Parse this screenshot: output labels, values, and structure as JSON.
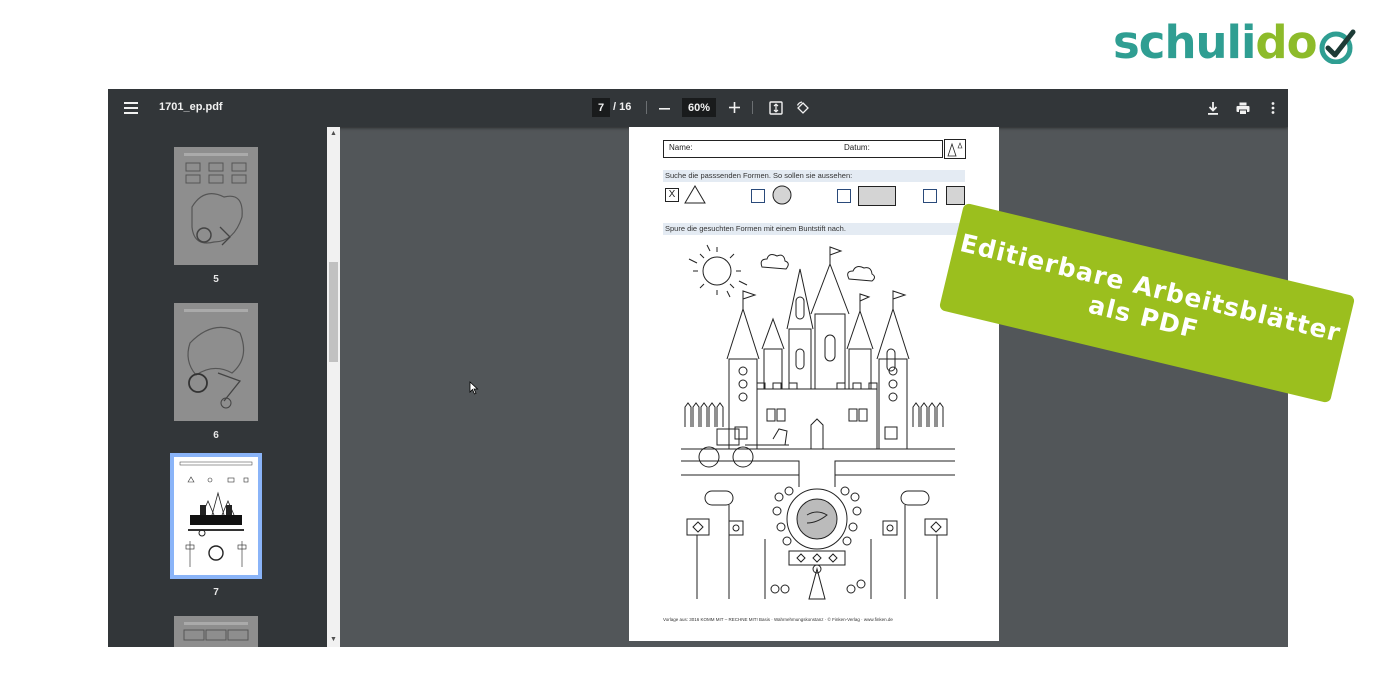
{
  "brand": {
    "logo_part1": "schuli",
    "logo_part2": "do",
    "teal": "#2f9e92",
    "green": "#8dbb2a",
    "check_icon": "check-circle-icon"
  },
  "viewer": {
    "filename": "1701_ep.pdf",
    "current_page": "7",
    "total_pages": "/ 16",
    "zoom": "60%",
    "icons": {
      "menu": "menu-icon",
      "zoom_out": "minus-icon",
      "zoom_in": "plus-icon",
      "fit": "fit-to-page-icon",
      "rotate": "rotate-icon",
      "download": "download-icon",
      "print": "print-icon",
      "more": "more-vert-icon"
    }
  },
  "sidebar": {
    "thumbnails": [
      {
        "label": "5"
      },
      {
        "label": "6"
      },
      {
        "label": "7",
        "selected": true
      },
      {
        "label": ""
      }
    ]
  },
  "worksheet": {
    "name_label": "Name:",
    "date_label": "Datum:",
    "task1": "Suche die passsenden Formen. So sollen sie aussehen:",
    "checkbox_mark": "X",
    "task2": "Spure die gesuchten Formen mit einem Buntstift nach.",
    "footer": "Vorlage aus: 3016 KOMM MIT – RECHNE MIT! Basis · Wahrnehmungskonstanz · © Finken-Verlag · www.finken.de"
  },
  "banner": {
    "line1": "Editierbare Arbeitsblätter",
    "line2": "als PDF",
    "color": "#9bbf1e"
  }
}
